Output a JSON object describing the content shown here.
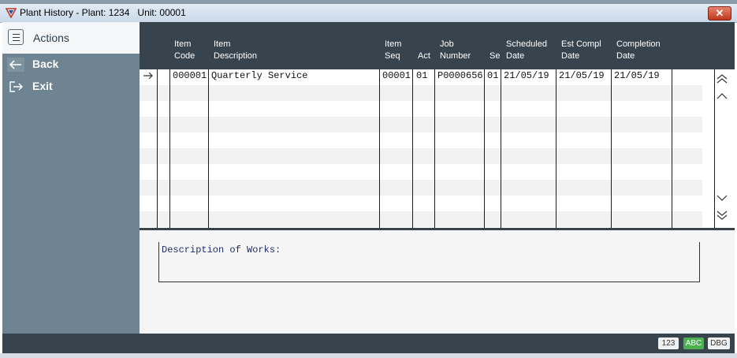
{
  "window": {
    "title": "Plant History - Plant: 1234   Unit: 00001",
    "close_symbol": "✕",
    "colors": {
      "frame": "#37444d",
      "sidebar": "#6f8492",
      "accent_green": "#4caf50"
    }
  },
  "sidebar": {
    "header_label": "Actions",
    "header_icon": "hamburger-icon",
    "items": [
      {
        "label": "Back",
        "icon": "arrow-left-icon"
      },
      {
        "label": "Exit",
        "icon": "exit-icon"
      }
    ]
  },
  "grid": {
    "columns": [
      {
        "line1": "Item",
        "line2": "Code"
      },
      {
        "line1": "Item",
        "line2": "Description"
      },
      {
        "line1": "Item",
        "line2": "Seq"
      },
      {
        "line1": "",
        "line2": "Act"
      },
      {
        "line1": "Job",
        "line2": "Number"
      },
      {
        "line1": "",
        "line2": "Se"
      },
      {
        "line1": "Scheduled",
        "line2": "Date"
      },
      {
        "line1": "Est Compl",
        "line2": "Date"
      },
      {
        "line1": "Completion",
        "line2": "Date"
      }
    ],
    "rows": [
      {
        "item_code": "000001",
        "item_description": "Quarterly Service",
        "item_seq": "00001",
        "act": "01",
        "job_number": "P0000656",
        "se": "01",
        "scheduled_date": "21/05/19",
        "est_compl_date": "21/05/19",
        "completion_date": "21/05/19"
      }
    ],
    "scroll_icons": [
      "double-chevron-up-icon",
      "chevron-up-icon",
      "chevron-down-icon",
      "double-chevron-down-icon"
    ]
  },
  "description": {
    "label": "Description of Works:"
  },
  "statusbar": {
    "badges": [
      {
        "label": "123",
        "color": "#f0f0f0"
      },
      {
        "label": "ABC",
        "color": "#4caf50"
      },
      {
        "label": "DBG",
        "color": "#f0f0f0"
      }
    ]
  }
}
